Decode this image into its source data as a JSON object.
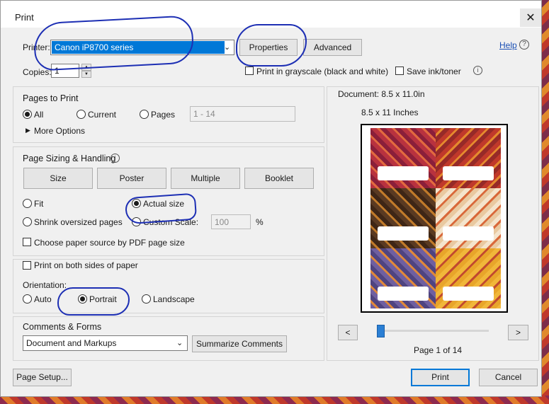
{
  "window": {
    "title": "Print",
    "close_glyph": "✕"
  },
  "printer": {
    "label": "Printer:",
    "selected": "Canon iP8700 series",
    "properties_label": "Properties",
    "advanced_label": "Advanced",
    "help_label": "Help",
    "help_glyph": "?"
  },
  "copies": {
    "label": "Copies:",
    "value": "1"
  },
  "options": {
    "grayscale_label": "Print in grayscale (black and white)",
    "grayscale_checked": false,
    "save_ink_label": "Save ink/toner",
    "save_ink_checked": false,
    "info_glyph": "i"
  },
  "pages_to_print": {
    "title": "Pages to Print",
    "all_label": "All",
    "current_label": "Current",
    "pages_label": "Pages",
    "pages_value": "1 - 14",
    "selected": "All",
    "more_options_label": "More Options",
    "expand_glyph": "▶"
  },
  "sizing": {
    "title": "Page Sizing & Handling",
    "info_glyph": "i",
    "tabs": [
      "Size",
      "Poster",
      "Multiple",
      "Booklet"
    ],
    "active_tab": "Size",
    "fit_label": "Fit",
    "actual_size_label": "Actual size",
    "shrink_label": "Shrink oversized pages",
    "custom_scale_label": "Custom Scale:",
    "custom_scale_value": "100",
    "percent_label": "%",
    "selected": "Actual size",
    "paper_source_label": "Choose paper source by PDF page size",
    "paper_source_checked": false
  },
  "duplex": {
    "label": "Print on both sides of paper",
    "checked": false
  },
  "orientation": {
    "title": "Orientation:",
    "auto_label": "Auto",
    "portrait_label": "Portrait",
    "landscape_label": "Landscape",
    "selected": "Portrait"
  },
  "comments_forms": {
    "title": "Comments & Forms",
    "selected": "Document and Markups",
    "summarize_label": "Summarize Comments"
  },
  "preview": {
    "document_label": "Document: 8.5 x 11.0in",
    "paper_label": "8.5 x 11 Inches",
    "prev_label": "<",
    "next_label": ">",
    "page_indicator": "Page 1 of 14",
    "current_page_fraction": 0.0714
  },
  "footer": {
    "page_setup_label": "Page Setup...",
    "print_label": "Print",
    "cancel_label": "Cancel"
  },
  "colors": {
    "accent": "#0078d7",
    "annotation_ink": "#1d2fb4",
    "tile_red": "#b8323f",
    "tile_dark_red": "#c0392b",
    "tile_brown": "#5a3a22",
    "tile_cream": "#f4e4cc",
    "tile_purple": "#6f5fa0",
    "tile_yellow": "#f1b73a"
  }
}
